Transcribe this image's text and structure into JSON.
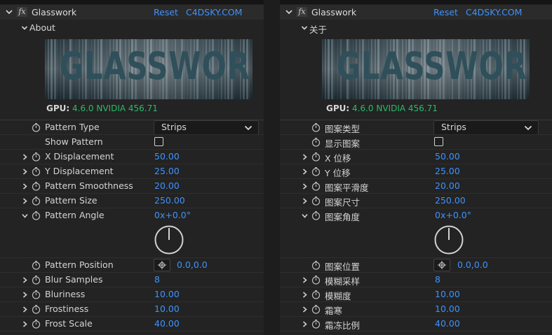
{
  "panels": [
    {
      "effect_title": "Glasswork",
      "reset_label": "Reset",
      "site_label": "C4DSKY.COM",
      "about_label": "About",
      "banner_text": "GLASSWORK",
      "gpu_key": "GPU:",
      "gpu_value": "4.6.0 NVIDIA 456.71",
      "dropdown_value": "Strips",
      "params": [
        {
          "label": "Pattern Type",
          "twirl": false,
          "stopwatch": true,
          "control": "dropdown"
        },
        {
          "label": "Show Pattern",
          "twirl": false,
          "stopwatch": false,
          "control": "checkbox"
        },
        {
          "label": "X Displacement",
          "twirl": true,
          "stopwatch": true,
          "value": "50.00"
        },
        {
          "label": "Y Displacement",
          "twirl": true,
          "stopwatch": true,
          "value": "25.00"
        },
        {
          "label": "Pattern Smoothness",
          "twirl": true,
          "stopwatch": true,
          "value": "20.00"
        },
        {
          "label": "Pattern Size",
          "twirl": true,
          "stopwatch": true,
          "value": "250.00"
        },
        {
          "label": "Pattern Angle",
          "twirl": "open",
          "stopwatch": true,
          "value": "0x+0.0°"
        },
        {
          "label": "Pattern Position",
          "twirl": false,
          "stopwatch": true,
          "value": "0.0,0.0"
        },
        {
          "label": "Blur Samples",
          "twirl": true,
          "stopwatch": true,
          "value": "8"
        },
        {
          "label": "Bluriness",
          "twirl": true,
          "stopwatch": true,
          "value": "10.00"
        },
        {
          "label": "Frostiness",
          "twirl": true,
          "stopwatch": true,
          "value": "10.00"
        },
        {
          "label": "Frost Scale",
          "twirl": true,
          "stopwatch": true,
          "value": "40.00"
        }
      ]
    },
    {
      "effect_title": "Glasswork",
      "reset_label": "Reset",
      "site_label": "C4DSKY.COM",
      "about_label": "关于",
      "banner_text": "GLASSWORK",
      "gpu_key": "GPU:",
      "gpu_value": "4.6.0 NVIDIA 456.71",
      "dropdown_value": "Strips",
      "params": [
        {
          "label": "图案类型",
          "twirl": false,
          "stopwatch": true,
          "control": "dropdown"
        },
        {
          "label": "显示图案",
          "twirl": false,
          "stopwatch": true,
          "control": "checkbox"
        },
        {
          "label": "X 位移",
          "twirl": true,
          "stopwatch": true,
          "value": "50.00"
        },
        {
          "label": "Y 位移",
          "twirl": true,
          "stopwatch": true,
          "value": "25.00"
        },
        {
          "label": "图案平滑度",
          "twirl": true,
          "stopwatch": true,
          "value": "20.00"
        },
        {
          "label": "图案尺寸",
          "twirl": true,
          "stopwatch": true,
          "value": "250.00"
        },
        {
          "label": "图案角度",
          "twirl": "open",
          "stopwatch": true,
          "value": "0x+0.0°"
        },
        {
          "label": "图案位置",
          "twirl": false,
          "stopwatch": true,
          "value": "0.0,0.0"
        },
        {
          "label": "模糊采样",
          "twirl": true,
          "stopwatch": true,
          "value": "8"
        },
        {
          "label": "模糊度",
          "twirl": true,
          "stopwatch": true,
          "value": "10.00"
        },
        {
          "label": "霜寒",
          "twirl": true,
          "stopwatch": true,
          "value": "10.00"
        },
        {
          "label": "霜冻比例",
          "twirl": true,
          "stopwatch": true,
          "value": "40.00"
        }
      ]
    }
  ],
  "colors": {
    "accent": "#3d93ff",
    "gpu_green": "#2bbb6a",
    "panel_bg": "#232323"
  },
  "icons": [
    "chevron-down-icon",
    "fx-icon",
    "twirl-arrow-icon",
    "stopwatch-icon",
    "crosshair-icon",
    "angle-dial-icon"
  ]
}
